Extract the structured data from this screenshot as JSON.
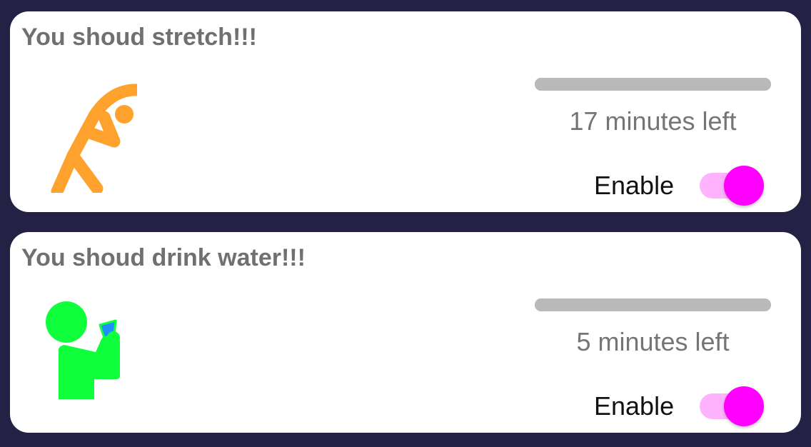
{
  "reminders": [
    {
      "title": "You shoud stretch!!!",
      "icon": "stretching-person-icon",
      "icon_color": "#FFA22D",
      "progress_fraction": 1.0,
      "time_left": "17 minutes left",
      "enable_label": "Enable",
      "enabled": true
    },
    {
      "title": "You shoud drink water!!!",
      "icon": "drinking-person-icon",
      "icon_color": "#10FF3C",
      "icon_accent_color": "#1F8FFF",
      "progress_fraction": 1.0,
      "time_left": "5 minutes left",
      "enable_label": "Enable",
      "enabled": true
    }
  ],
  "colors": {
    "background": "#232244",
    "card": "#FFFFFF",
    "title_text": "#707070",
    "progress_track": "#B9B9B9",
    "toggle_thumb": "#FF00FF",
    "toggle_track": "#FFB3FF"
  }
}
